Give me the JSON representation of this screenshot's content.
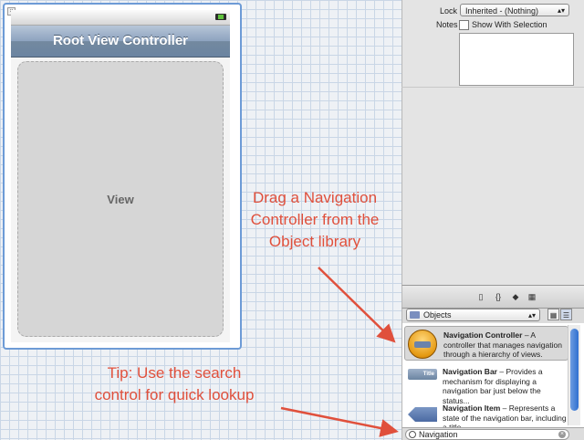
{
  "scene": {
    "nav_title": "Root View Controller",
    "view_label": "View"
  },
  "annotations": {
    "drag_lines": [
      "Drag a Navigation",
      "Controller from the",
      "Object library"
    ],
    "tip_lines": [
      "Tip: Use the search",
      "control for quick lookup"
    ]
  },
  "inspector": {
    "lock_label": "Lock",
    "lock_value": "Inherited - (Nothing)",
    "notes_label": "Notes",
    "show_with_selection_label": "Show With Selection"
  },
  "library": {
    "tabs": [
      "file-icon",
      "braces-icon",
      "cube-icon",
      "media-icon"
    ],
    "filter_value": "Objects",
    "items": [
      {
        "name": "Navigation Controller",
        "desc": "– A controller that manages navigation through a hierarchy of views."
      },
      {
        "name": "Navigation Bar",
        "desc": "– Provides a mechanism for displaying a navigation bar just below the status..."
      },
      {
        "name": "Navigation Item",
        "desc": "– Represents a state of the navigation bar, including a title"
      }
    ],
    "search_value": "Navigation"
  },
  "colors": {
    "annotation": "#e0503c",
    "selection_outline": "#6d9bd6"
  }
}
